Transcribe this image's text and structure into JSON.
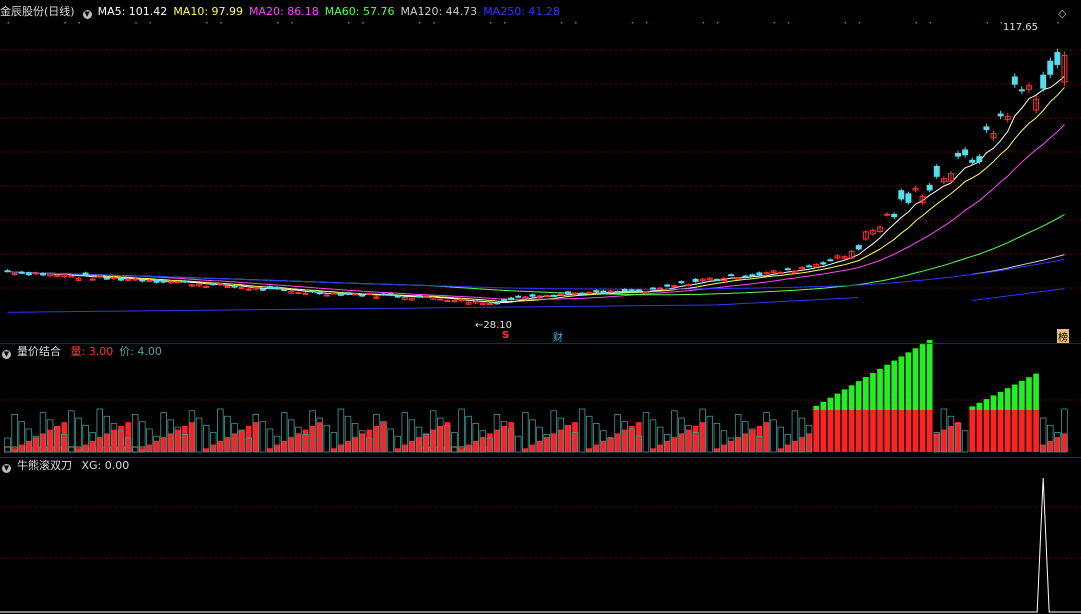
{
  "main_panel": {
    "title": "金辰股份(日线)",
    "mas": [
      {
        "label": "MA5:",
        "value": "101.42",
        "color": "#ffffff"
      },
      {
        "label": "MA10:",
        "value": "97.99",
        "color": "#ffff55"
      },
      {
        "label": "MA20:",
        "value": "86.18",
        "color": "#ff44ff"
      },
      {
        "label": "MA60:",
        "value": "57.76",
        "color": "#55ff55"
      },
      {
        "label": "MA120:",
        "value": "44.73",
        "color": "#cccccc"
      },
      {
        "label": "MA250:",
        "value": "41.28",
        "color": "#3333ff"
      }
    ],
    "high_label": "117.65",
    "low_label": "28.10",
    "marker_s": "S",
    "marker_cai": "财",
    "marker_bang": "榜"
  },
  "vol_panel": {
    "title": "量价结合",
    "items": [
      {
        "label": "量:",
        "value": "3.00",
        "color": "#ff3333"
      },
      {
        "label": "价:",
        "value": "4.00",
        "color": "#44aaaa"
      }
    ]
  },
  "ind_panel": {
    "title": "牛熊滚双刀",
    "items": [
      {
        "label": "XG:",
        "value": "0.00",
        "color": "#dddddd"
      }
    ]
  },
  "chart_data": {
    "type": "candlestick",
    "price_range": [
      20,
      125
    ],
    "grid": true,
    "bars": 150,
    "anchors_close": [
      [
        0,
        40
      ],
      [
        10,
        38
      ],
      [
        20,
        37
      ],
      [
        40,
        33
      ],
      [
        60,
        31
      ],
      [
        68,
        29
      ],
      [
        74,
        32
      ],
      [
        90,
        33
      ],
      [
        98,
        37
      ],
      [
        110,
        40
      ],
      [
        118,
        45
      ],
      [
        125,
        60
      ],
      [
        130,
        70
      ],
      [
        137,
        80
      ],
      [
        142,
        100
      ],
      [
        147,
        104
      ],
      [
        149,
        117
      ]
    ],
    "high": 117.65,
    "low": 28.1,
    "volume_ramps": [
      {
        "start": 113,
        "end": 130,
        "max_green": 5.0
      },
      {
        "start": 135,
        "end": 145,
        "max_green": 2.6
      }
    ],
    "xg_signal": {
      "bar": 146,
      "value": 1
    }
  }
}
